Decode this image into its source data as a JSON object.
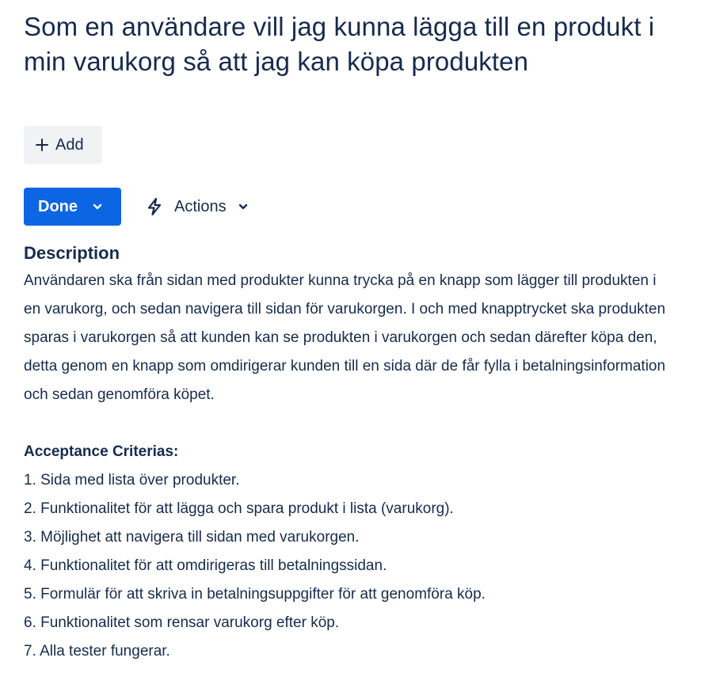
{
  "issue": {
    "title": "Som en användare vill jag kunna lägga till en produkt i min varukorg så att jag kan köpa produkten"
  },
  "toolbar": {
    "add_label": "Add",
    "status_label": "Done",
    "actions_label": "Actions"
  },
  "icons": {
    "add": "plus-icon",
    "status_dropdown": "chevron-down-icon",
    "actions": "lightning-bolt-icon",
    "actions_dropdown": "chevron-down-icon"
  },
  "colors": {
    "status_done_bg": "#0c66e4",
    "add_button_bg": "#f1f2f4",
    "text": "#172b4d"
  },
  "description": {
    "heading": "Description",
    "body": "Användaren ska från sidan med produkter kunna trycka på en knapp som lägger till produkten i en varukorg, och sedan navigera till sidan för varukorgen. I och med knapptrycket ska produkten sparas i varukorgen så att kunden kan se produkten i varukorgen och sedan därefter köpa den, detta genom en knapp som omdirigerar kunden till en sida där de får fylla i betalningsinformation och sedan genomföra köpet.",
    "acceptance_heading": "Acceptance Criterias:",
    "criteria": [
      "1. Sida med lista över produkter.",
      "2. Funktionalitet för att lägga och spara produkt i lista (varukorg).",
      "3. Möjlighet att navigera till sidan med varukorgen.",
      "4. Funktionalitet för att omdirigeras till betalningssidan.",
      "5. Formulär för att skriva in betalningsuppgifter för att genomföra köp.",
      "6. Funktionalitet som rensar varukorg efter köp.",
      "7. Alla tester fungerar."
    ]
  }
}
